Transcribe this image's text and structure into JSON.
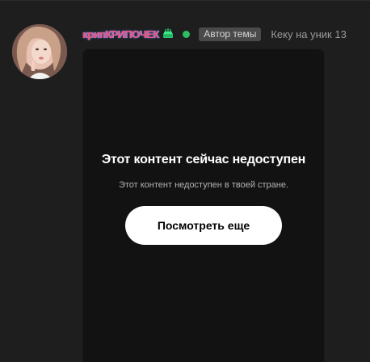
{
  "post": {
    "author": {
      "username": "крипКРИПОЧЕК",
      "badge": "Автор темы",
      "title": "Кеку на уник 13",
      "avatar_icon": "user-avatar-photo",
      "online": true,
      "online_color": "#2bbf5f",
      "birthday_icon": "cake-icon"
    },
    "embed": {
      "title": "Этот контент сейчас недоступен",
      "subtitle": "Этот контент недоступен в твоей стране.",
      "button_label": "Посмотреть еще"
    }
  }
}
